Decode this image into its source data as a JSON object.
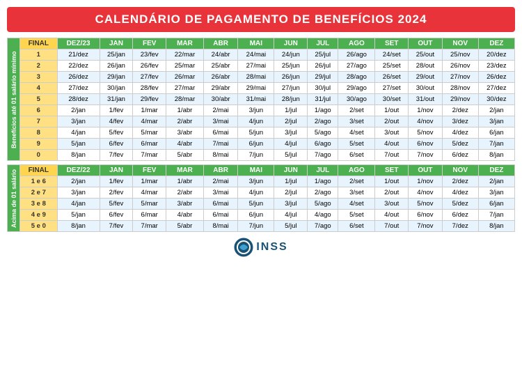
{
  "title": "CALENDÁRIO DE PAGAMENTO DE BENEFÍCIOS 2024",
  "top_section_label": "Benefícios até 01 salário mínimo",
  "bottom_section_label": "Acima de 01 salário",
  "top_header": [
    "FINAL",
    "DEZ/23",
    "JAN",
    "FEV",
    "MAR",
    "ABR",
    "MAI",
    "JUN",
    "JUL",
    "AGO",
    "SET",
    "OUT",
    "NOV",
    "DEZ"
  ],
  "top_rows": [
    [
      "1",
      "21/dez",
      "25/jan",
      "23/fev",
      "22/mar",
      "24/abr",
      "24/mai",
      "24/jun",
      "25/jul",
      "26/ago",
      "24/set",
      "25/out",
      "25/nov",
      "20/dez"
    ],
    [
      "2",
      "22/dez",
      "26/jan",
      "26/fev",
      "25/mar",
      "25/abr",
      "27/mai",
      "25/jun",
      "26/jul",
      "27/ago",
      "25/set",
      "28/out",
      "26/nov",
      "23/dez"
    ],
    [
      "3",
      "26/dez",
      "29/jan",
      "27/fev",
      "26/mar",
      "26/abr",
      "28/mai",
      "26/jun",
      "29/jul",
      "28/ago",
      "26/set",
      "29/out",
      "27/nov",
      "26/dez"
    ],
    [
      "4",
      "27/dez",
      "30/jan",
      "28/fev",
      "27/mar",
      "29/abr",
      "29/mai",
      "27/jun",
      "30/jul",
      "29/ago",
      "27/set",
      "30/out",
      "28/nov",
      "27/dez"
    ],
    [
      "5",
      "28/dez",
      "31/jan",
      "29/fev",
      "28/mar",
      "30/abr",
      "31/mai",
      "28/jun",
      "31/jul",
      "30/ago",
      "30/set",
      "31/out",
      "29/nov",
      "30/dez"
    ],
    [
      "6",
      "2/jan",
      "1/fev",
      "1/mar",
      "1/abr",
      "2/mai",
      "3/jun",
      "1/jul",
      "1/ago",
      "2/set",
      "1/out",
      "1/nov",
      "2/dez",
      "2/jan"
    ],
    [
      "7",
      "3/jan",
      "4/fev",
      "4/mar",
      "2/abr",
      "3/mai",
      "4/jun",
      "2/jul",
      "2/ago",
      "3/set",
      "2/out",
      "4/nov",
      "3/dez",
      "3/jan"
    ],
    [
      "8",
      "4/jan",
      "5/fev",
      "5/mar",
      "3/abr",
      "6/mai",
      "5/jun",
      "3/jul",
      "5/ago",
      "4/set",
      "3/out",
      "5/nov",
      "4/dez",
      "6/jan"
    ],
    [
      "9",
      "5/jan",
      "6/fev",
      "6/mar",
      "4/abr",
      "7/mai",
      "6/jun",
      "4/jul",
      "6/ago",
      "5/set",
      "4/out",
      "6/nov",
      "5/dez",
      "7/jan"
    ],
    [
      "0",
      "8/jan",
      "7/fev",
      "7/mar",
      "5/abr",
      "8/mai",
      "7/jun",
      "5/jul",
      "7/ago",
      "6/set",
      "7/out",
      "7/nov",
      "6/dez",
      "8/jan"
    ]
  ],
  "bottom_header": [
    "FINAL",
    "DEZ/22",
    "JAN",
    "FEV",
    "MAR",
    "ABR",
    "MAI",
    "JUN",
    "JUL",
    "AGO",
    "SET",
    "OUT",
    "NOV",
    "DEZ"
  ],
  "bottom_rows": [
    [
      "1 e 6",
      "2/jan",
      "1/fev",
      "1/mar",
      "1/abr",
      "2/mai",
      "3/jun",
      "1/jul",
      "1/ago",
      "2/set",
      "1/out",
      "1/nov",
      "2/dez",
      "2/jan"
    ],
    [
      "2 e 7",
      "3/jan",
      "2/fev",
      "4/mar",
      "2/abr",
      "3/mai",
      "4/jun",
      "2/jul",
      "2/ago",
      "3/set",
      "2/out",
      "4/nov",
      "4/dez",
      "3/jan"
    ],
    [
      "3 e 8",
      "4/jan",
      "5/fev",
      "5/mar",
      "3/abr",
      "6/mai",
      "5/jun",
      "3/jul",
      "5/ago",
      "4/set",
      "3/out",
      "5/nov",
      "5/dez",
      "6/jan"
    ],
    [
      "4 e 9",
      "5/jan",
      "6/fev",
      "6/mar",
      "4/abr",
      "6/mai",
      "6/jun",
      "4/jul",
      "4/ago",
      "5/set",
      "4/out",
      "6/nov",
      "6/dez",
      "7/jan"
    ],
    [
      "5 e 0",
      "8/jan",
      "7/fev",
      "7/mar",
      "5/abr",
      "8/mai",
      "7/jun",
      "5/jul",
      "7/ago",
      "6/set",
      "7/out",
      "7/nov",
      "7/dez",
      "8/jan"
    ]
  ],
  "footer": {
    "logo_text": "INSS"
  }
}
